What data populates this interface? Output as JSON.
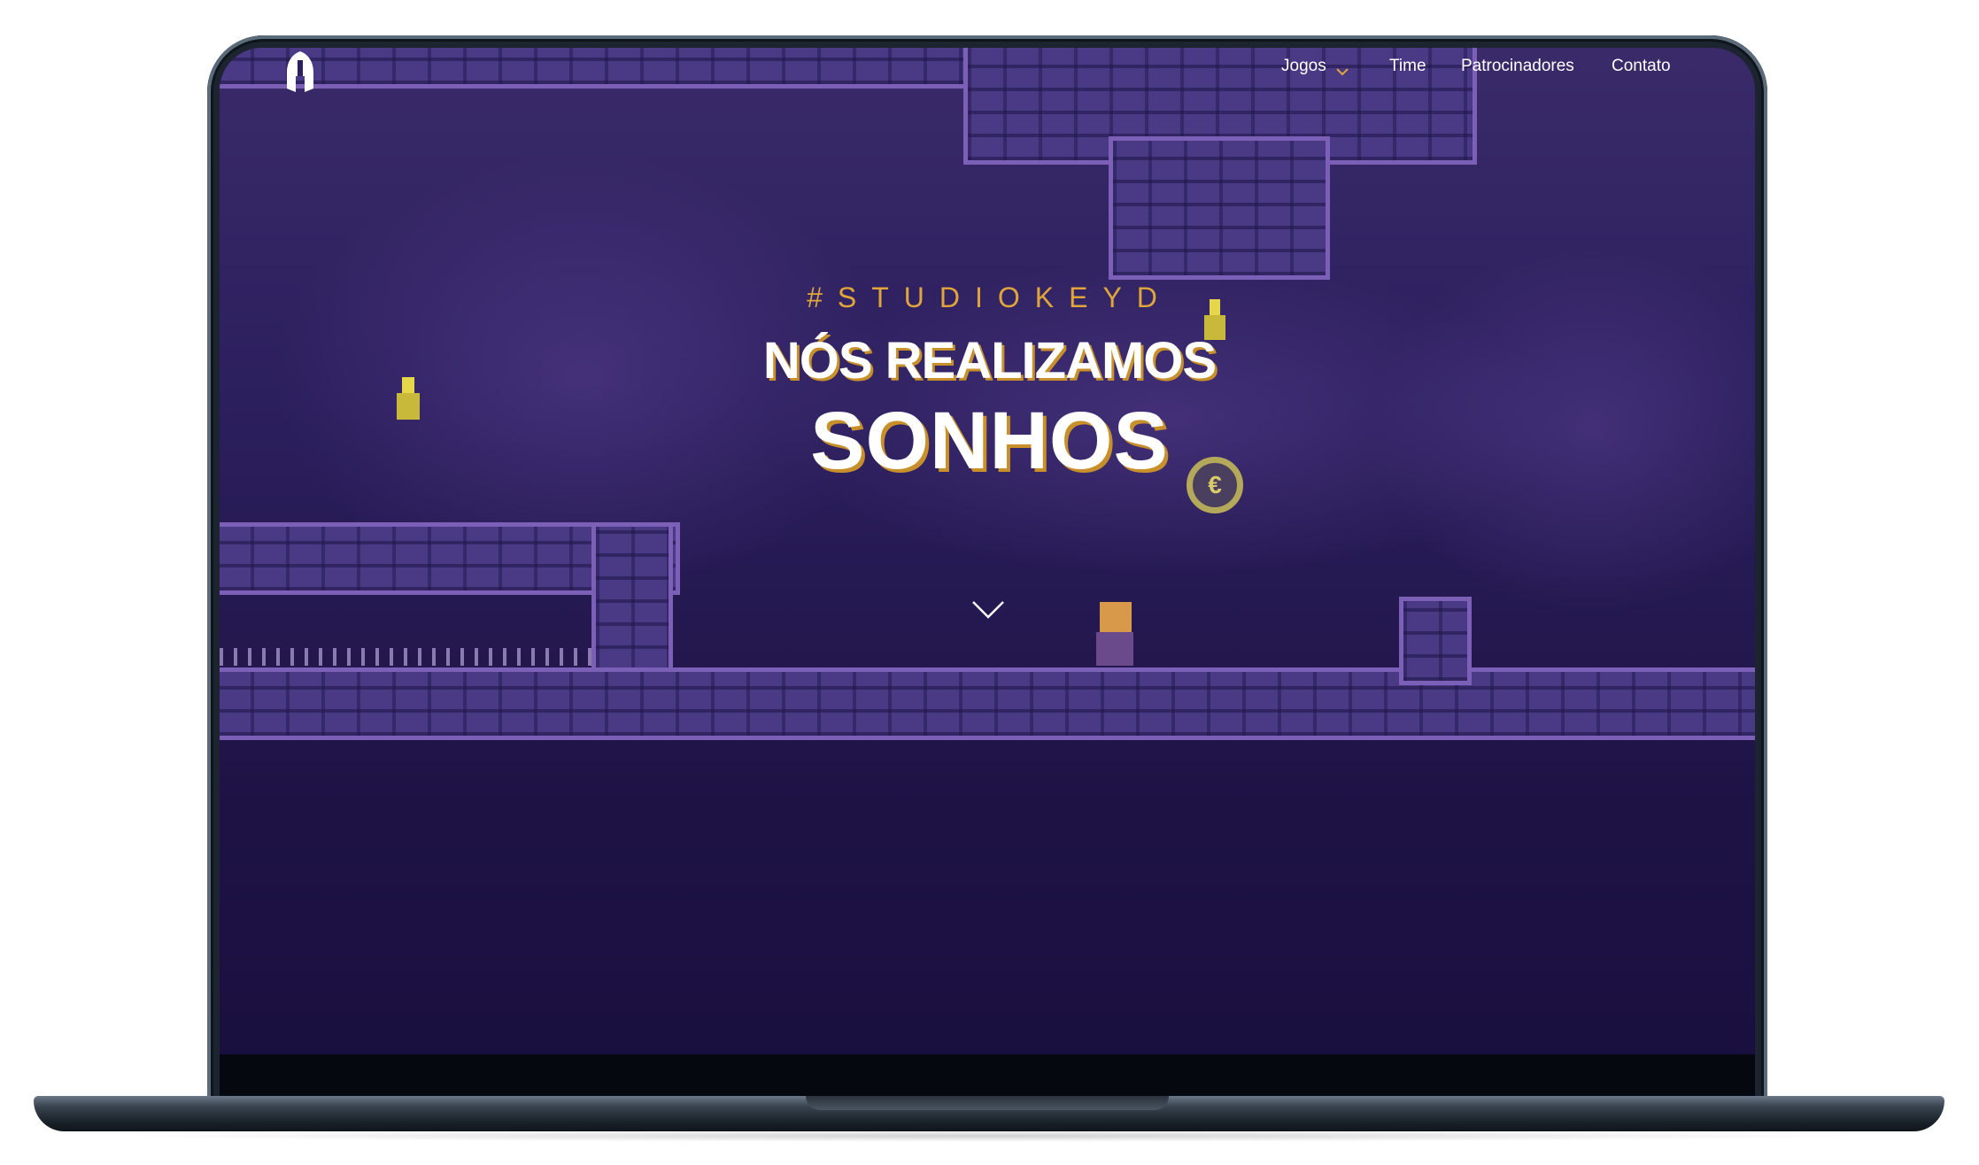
{
  "nav": {
    "items": [
      {
        "label": "Jogos",
        "has_dropdown": true
      },
      {
        "label": "Time"
      },
      {
        "label": "Patrocinadores"
      },
      {
        "label": "Contato"
      }
    ]
  },
  "hero": {
    "tag": "#STUDIOKEYD",
    "line1": "NÓS REALIZAMOS",
    "line2": "SONHOS"
  },
  "icons": {
    "logo": "spartan-helmet-icon",
    "dropdown": "chevron-down-icon",
    "scroll": "chevron-down-icon"
  },
  "colors": {
    "accent": "#e0a63a",
    "background": "#24184f",
    "text": "#ffffff"
  }
}
